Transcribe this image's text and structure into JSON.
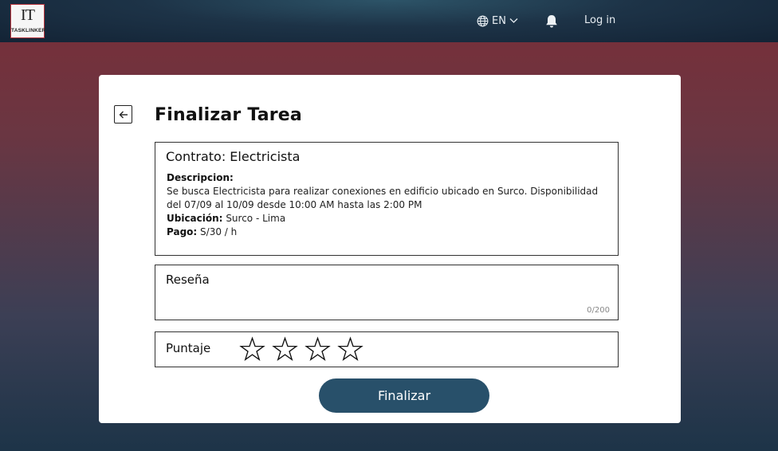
{
  "header": {
    "logo": {
      "mark": "IT",
      "brand": "TASKLINKER"
    },
    "language": {
      "code": "EN",
      "icon": "globe-icon",
      "dropdown_icon": "chevron-down-icon"
    },
    "notifications_icon": "bell-icon",
    "login_label": "Log in"
  },
  "page": {
    "title": "Finalizar Tarea",
    "back_icon": "arrow-left-icon"
  },
  "contract": {
    "title": "Contrato: Electricista",
    "description_label": "Descripcion:",
    "description": "Se busca Electricista para realizar conexiones en edificio ubicado en Surco. Disponibilidad del 07/09 al 10/09 desde 10:00 AM hasta las 2:00 PM",
    "location_label": "Ubicación:",
    "location": "Surco - Lima",
    "payment_label": "Pago:",
    "payment": "S/30 / h"
  },
  "review": {
    "label": "Reseña",
    "value": "",
    "counter": "0/200"
  },
  "score": {
    "label": "Puntaje",
    "star_count": 4,
    "rating": 0,
    "star_icon": "star-outline-icon"
  },
  "actions": {
    "finish_label": "Finalizar"
  },
  "colors": {
    "header_bg": "#1d3347",
    "button_bg": "#28506a",
    "background_top": "#7a2e38",
    "background_bottom": "#1d3448"
  }
}
